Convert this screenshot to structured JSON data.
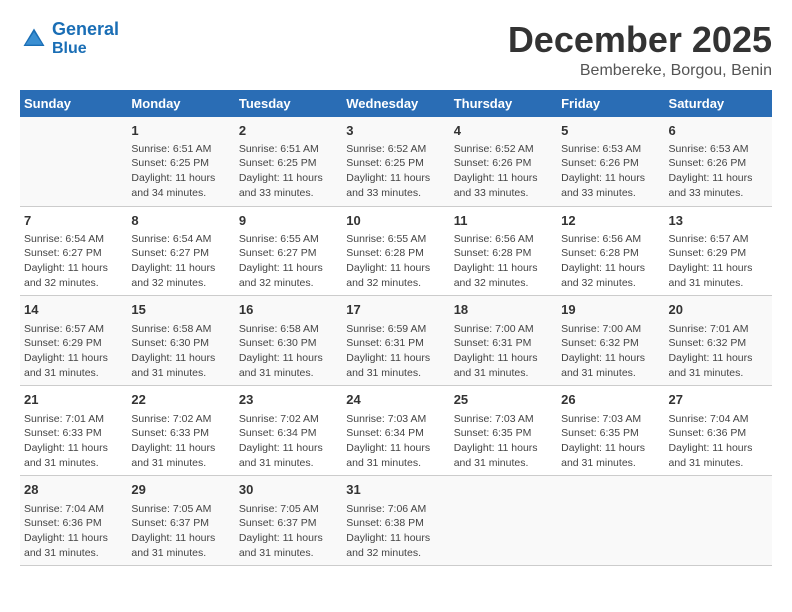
{
  "logo": {
    "line1": "General",
    "line2": "Blue"
  },
  "title": {
    "month_year": "December 2025",
    "location": "Bembereke, Borgou, Benin"
  },
  "headers": [
    "Sunday",
    "Monday",
    "Tuesday",
    "Wednesday",
    "Thursday",
    "Friday",
    "Saturday"
  ],
  "weeks": [
    [
      {
        "day": "",
        "info": ""
      },
      {
        "day": "1",
        "info": "Sunrise: 6:51 AM\nSunset: 6:25 PM\nDaylight: 11 hours\nand 34 minutes."
      },
      {
        "day": "2",
        "info": "Sunrise: 6:51 AM\nSunset: 6:25 PM\nDaylight: 11 hours\nand 33 minutes."
      },
      {
        "day": "3",
        "info": "Sunrise: 6:52 AM\nSunset: 6:25 PM\nDaylight: 11 hours\nand 33 minutes."
      },
      {
        "day": "4",
        "info": "Sunrise: 6:52 AM\nSunset: 6:26 PM\nDaylight: 11 hours\nand 33 minutes."
      },
      {
        "day": "5",
        "info": "Sunrise: 6:53 AM\nSunset: 6:26 PM\nDaylight: 11 hours\nand 33 minutes."
      },
      {
        "day": "6",
        "info": "Sunrise: 6:53 AM\nSunset: 6:26 PM\nDaylight: 11 hours\nand 33 minutes."
      }
    ],
    [
      {
        "day": "7",
        "info": "Sunrise: 6:54 AM\nSunset: 6:27 PM\nDaylight: 11 hours\nand 32 minutes."
      },
      {
        "day": "8",
        "info": "Sunrise: 6:54 AM\nSunset: 6:27 PM\nDaylight: 11 hours\nand 32 minutes."
      },
      {
        "day": "9",
        "info": "Sunrise: 6:55 AM\nSunset: 6:27 PM\nDaylight: 11 hours\nand 32 minutes."
      },
      {
        "day": "10",
        "info": "Sunrise: 6:55 AM\nSunset: 6:28 PM\nDaylight: 11 hours\nand 32 minutes."
      },
      {
        "day": "11",
        "info": "Sunrise: 6:56 AM\nSunset: 6:28 PM\nDaylight: 11 hours\nand 32 minutes."
      },
      {
        "day": "12",
        "info": "Sunrise: 6:56 AM\nSunset: 6:28 PM\nDaylight: 11 hours\nand 32 minutes."
      },
      {
        "day": "13",
        "info": "Sunrise: 6:57 AM\nSunset: 6:29 PM\nDaylight: 11 hours\nand 31 minutes."
      }
    ],
    [
      {
        "day": "14",
        "info": "Sunrise: 6:57 AM\nSunset: 6:29 PM\nDaylight: 11 hours\nand 31 minutes."
      },
      {
        "day": "15",
        "info": "Sunrise: 6:58 AM\nSunset: 6:30 PM\nDaylight: 11 hours\nand 31 minutes."
      },
      {
        "day": "16",
        "info": "Sunrise: 6:58 AM\nSunset: 6:30 PM\nDaylight: 11 hours\nand 31 minutes."
      },
      {
        "day": "17",
        "info": "Sunrise: 6:59 AM\nSunset: 6:31 PM\nDaylight: 11 hours\nand 31 minutes."
      },
      {
        "day": "18",
        "info": "Sunrise: 7:00 AM\nSunset: 6:31 PM\nDaylight: 11 hours\nand 31 minutes."
      },
      {
        "day": "19",
        "info": "Sunrise: 7:00 AM\nSunset: 6:32 PM\nDaylight: 11 hours\nand 31 minutes."
      },
      {
        "day": "20",
        "info": "Sunrise: 7:01 AM\nSunset: 6:32 PM\nDaylight: 11 hours\nand 31 minutes."
      }
    ],
    [
      {
        "day": "21",
        "info": "Sunrise: 7:01 AM\nSunset: 6:33 PM\nDaylight: 11 hours\nand 31 minutes."
      },
      {
        "day": "22",
        "info": "Sunrise: 7:02 AM\nSunset: 6:33 PM\nDaylight: 11 hours\nand 31 minutes."
      },
      {
        "day": "23",
        "info": "Sunrise: 7:02 AM\nSunset: 6:34 PM\nDaylight: 11 hours\nand 31 minutes."
      },
      {
        "day": "24",
        "info": "Sunrise: 7:03 AM\nSunset: 6:34 PM\nDaylight: 11 hours\nand 31 minutes."
      },
      {
        "day": "25",
        "info": "Sunrise: 7:03 AM\nSunset: 6:35 PM\nDaylight: 11 hours\nand 31 minutes."
      },
      {
        "day": "26",
        "info": "Sunrise: 7:03 AM\nSunset: 6:35 PM\nDaylight: 11 hours\nand 31 minutes."
      },
      {
        "day": "27",
        "info": "Sunrise: 7:04 AM\nSunset: 6:36 PM\nDaylight: 11 hours\nand 31 minutes."
      }
    ],
    [
      {
        "day": "28",
        "info": "Sunrise: 7:04 AM\nSunset: 6:36 PM\nDaylight: 11 hours\nand 31 minutes."
      },
      {
        "day": "29",
        "info": "Sunrise: 7:05 AM\nSunset: 6:37 PM\nDaylight: 11 hours\nand 31 minutes."
      },
      {
        "day": "30",
        "info": "Sunrise: 7:05 AM\nSunset: 6:37 PM\nDaylight: 11 hours\nand 31 minutes."
      },
      {
        "day": "31",
        "info": "Sunrise: 7:06 AM\nSunset: 6:38 PM\nDaylight: 11 hours\nand 32 minutes."
      },
      {
        "day": "",
        "info": ""
      },
      {
        "day": "",
        "info": ""
      },
      {
        "day": "",
        "info": ""
      }
    ]
  ]
}
